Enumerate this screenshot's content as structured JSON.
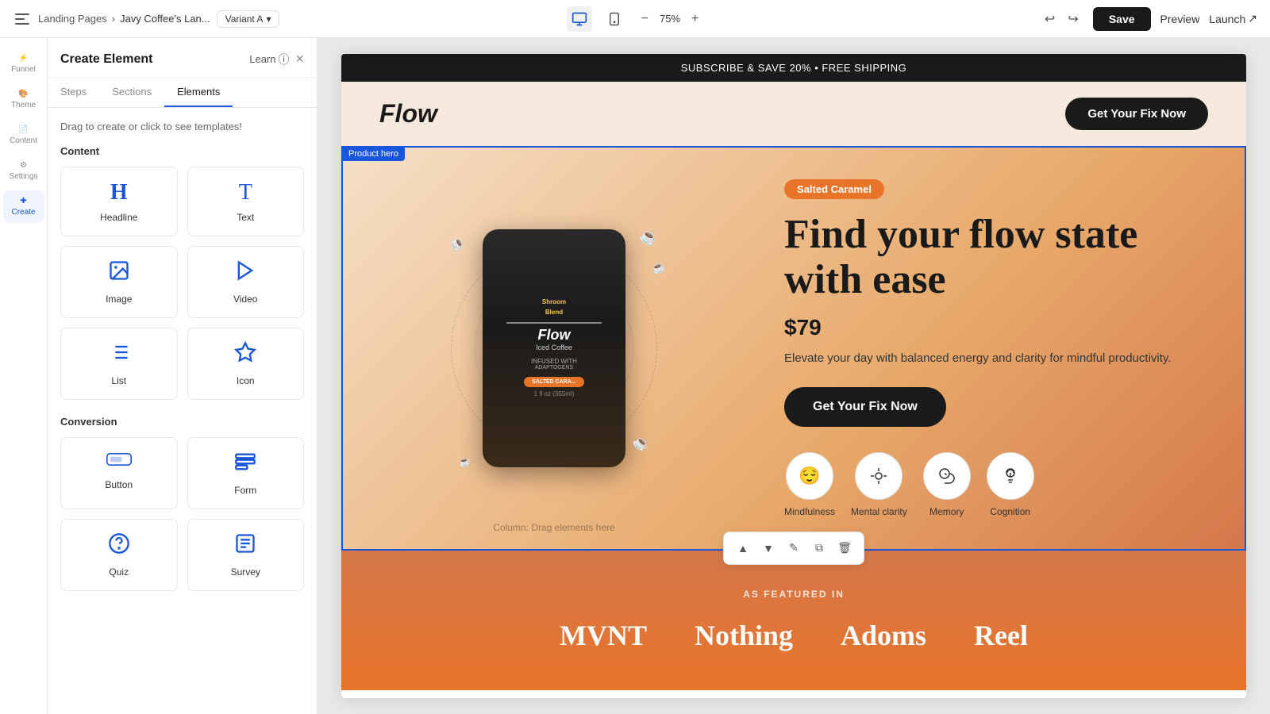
{
  "topbar": {
    "breadcrumb": {
      "root": "Landing Pages",
      "separator": "›",
      "current": "Javy Coffee's Lan..."
    },
    "variant": "Variant A",
    "zoom": "75%",
    "save_label": "Save",
    "preview_label": "Preview",
    "launch_label": "Launch"
  },
  "sidebar": {
    "items": [
      {
        "id": "funnel",
        "label": "Funnel",
        "icon": "⚡"
      },
      {
        "id": "theme",
        "label": "Theme",
        "icon": "🎨"
      },
      {
        "id": "content",
        "label": "Content",
        "icon": "📄"
      },
      {
        "id": "settings",
        "label": "Settings",
        "icon": "⚙"
      },
      {
        "id": "create",
        "label": "Create",
        "icon": "✚",
        "active": true
      }
    ]
  },
  "panel": {
    "title": "Create Element",
    "learn_label": "Learn",
    "tabs": [
      "Steps",
      "Sections",
      "Elements"
    ],
    "active_tab": "Elements",
    "drag_hint": "Drag to create or click to see templates!",
    "sections": {
      "content": {
        "label": "Content",
        "elements": [
          {
            "id": "headline",
            "label": "Headline",
            "icon": "H"
          },
          {
            "id": "text",
            "label": "Text",
            "icon": "T"
          },
          {
            "id": "image",
            "label": "Image",
            "icon": "🖼"
          },
          {
            "id": "video",
            "label": "Video",
            "icon": "▶"
          },
          {
            "id": "list",
            "label": "List",
            "icon": "≡"
          },
          {
            "id": "icon",
            "label": "Icon",
            "icon": "★"
          }
        ]
      },
      "conversion": {
        "label": "Conversion",
        "elements": [
          {
            "id": "button",
            "label": "Button",
            "icon": "⬜"
          },
          {
            "id": "form",
            "label": "Form",
            "icon": "▬"
          },
          {
            "id": "quiz",
            "label": "Quiz",
            "icon": "?"
          },
          {
            "id": "survey",
            "label": "Survey",
            "icon": "📋"
          }
        ]
      }
    }
  },
  "canvas": {
    "announcement_bar": "SUBSCRIBE & SAVE 20% • FREE SHIPPING",
    "brand_name": "Flow",
    "header_cta": "Get Your Fix Now",
    "product_hero": {
      "label": "Product hero",
      "badge": "Salted Caramel",
      "headline": "Find your flow state with ease",
      "price": "$79",
      "description": "Elevate your day with balanced energy and clarity for mindful productivity.",
      "cta_button": "Get Your Fix Now",
      "column_hint": "Column: Drag elements here",
      "can_top_text": "Shroom Blend",
      "can_brand": "Flow",
      "can_sub": "Iced Coffee",
      "benefits": [
        {
          "label": "Mindfulness",
          "icon": "😌"
        },
        {
          "label": "Mental clarity",
          "icon": "☀"
        },
        {
          "label": "Memory",
          "icon": "🧠"
        },
        {
          "label": "Cognition",
          "icon": "🧠"
        }
      ]
    },
    "featured": {
      "label": "AS FEATURED IN",
      "brands": [
        "MVNT",
        "Nothing",
        "Adoms",
        "Reel"
      ]
    }
  }
}
